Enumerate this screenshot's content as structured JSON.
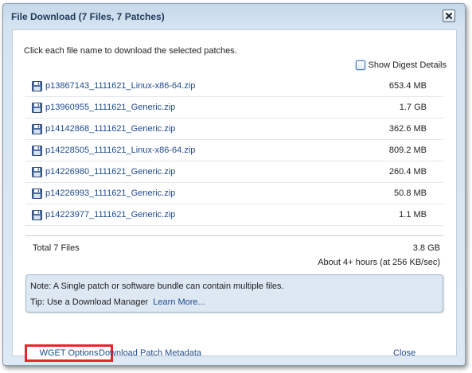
{
  "dialog": {
    "title": "File Download (7 Files, 7 Patches)",
    "close_icon": "close-x-icon"
  },
  "intro_text": "Click each file name to download the selected patches.",
  "digest": {
    "label": "Show Digest Details",
    "checked": false
  },
  "files": [
    {
      "name": "p13867143_1111621_Linux-x86-64.zip",
      "size": "653.4 MB",
      "icon": "floppy-disk-icon"
    },
    {
      "name": "p13960955_1111621_Generic.zip",
      "size": "1.7 GB",
      "icon": "floppy-disk-icon"
    },
    {
      "name": "p14142868_1111621_Generic.zip",
      "size": "362.6 MB",
      "icon": "floppy-disk-icon"
    },
    {
      "name": "p14228505_1111621_Linux-x86-64.zip",
      "size": "809.2 MB",
      "icon": "floppy-disk-icon"
    },
    {
      "name": "p14226980_1111621_Generic.zip",
      "size": "260.4 MB",
      "icon": "floppy-disk-icon"
    },
    {
      "name": "p14226993_1111621_Generic.zip",
      "size": "50.8 MB",
      "icon": "floppy-disk-icon"
    },
    {
      "name": "p14223977_1111621_Generic.zip",
      "size": "1.1 MB",
      "icon": "floppy-disk-icon"
    }
  ],
  "summary": {
    "total_label": "Total 7 Files",
    "total_size": "3.8 GB",
    "estimate": "About 4+ hours (at 256 KB/sec)"
  },
  "note": {
    "line1": "Note: A Single patch or software bundle can contain multiple files.",
    "tip": "Tip: Use a Download Manager",
    "learn_more": "Learn More..."
  },
  "footer": {
    "wget_options": "WGET Options",
    "download_metadata": "Download Patch Metadata",
    "close": "Close"
  },
  "colors": {
    "link": "#1f4b8f",
    "highlight_border": "#e8252c",
    "title_bar": "#c5d8ea"
  }
}
